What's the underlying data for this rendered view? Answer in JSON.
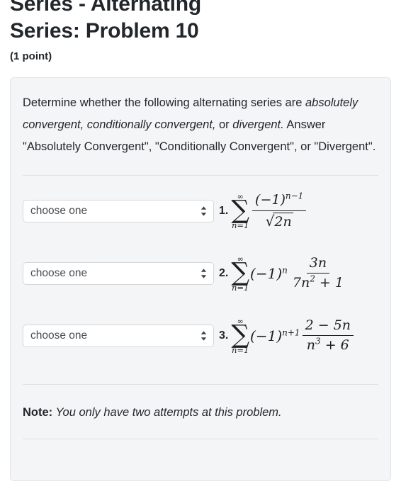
{
  "header": {
    "title_line1": "Series - Alternating",
    "title_line2": "Series: Problem 10",
    "points": "(1 point)"
  },
  "prompt": {
    "part1": "Determine whether the following alternating series are ",
    "em1": "absolutely convergent, conditionally convergent,",
    "part2": " or ",
    "em2": "divergent.",
    "part3": " Answer \"Absolutely Convergent\", \"Conditionally Convergent\", or \"Divergent\"."
  },
  "answers": [
    {
      "number": "1.",
      "select_value": "choose one",
      "select_placeholder": "choose one",
      "chevron_icon": "chevron-up-down-icon",
      "formula_text": "sum_{n=1}^{infinity} (-1)^{n-1} / sqrt(2n)",
      "sum_upper": "∞",
      "sum_sigma": "∑",
      "sum_lower": "n=1",
      "numerator_base": "(−1)",
      "numerator_exponent": "n−1",
      "denominator_radicand": "2n"
    },
    {
      "number": "2.",
      "select_value": "choose one",
      "select_placeholder": "choose one",
      "chevron_icon": "chevron-up-down-icon",
      "formula_text": "sum_{n=1}^{infinity} (-1)^n * 3n / (7n^2 + 1)",
      "sum_upper": "∞",
      "sum_sigma": "∑",
      "sum_lower": "n=1",
      "factor_base": "(−1)",
      "factor_exponent": "n",
      "frac_numerator": "3n",
      "frac_den_coeff": "7n",
      "frac_den_exponent": "2",
      "frac_den_tail": " + 1"
    },
    {
      "number": "3.",
      "select_value": "choose one",
      "select_placeholder": "choose one",
      "chevron_icon": "chevron-up-down-icon",
      "formula_text": "sum_{n=1}^{infinity} (-1)^{n+1} * (2 - 5n) / (n^3 + 6)",
      "sum_upper": "∞",
      "sum_sigma": "∑",
      "sum_lower": "n=1",
      "factor_base": "(−1)",
      "factor_exponent": "n+1",
      "frac_numerator": "2 − 5n",
      "frac_den_coeff": "n",
      "frac_den_exponent": "3",
      "frac_den_tail": " + 6"
    }
  ],
  "select_options": [
    "choose one"
  ],
  "note": {
    "label": "Note:",
    "text": " You only have two attempts at this problem."
  },
  "colors": {
    "page_background": "#ffffff",
    "card_background": "#f4f5f6",
    "card_border": "#e3e4e6",
    "divider": "#dfe0e2",
    "text": "#23272b",
    "select_border": "#d6d7d9",
    "select_text": "#4a4d51"
  }
}
